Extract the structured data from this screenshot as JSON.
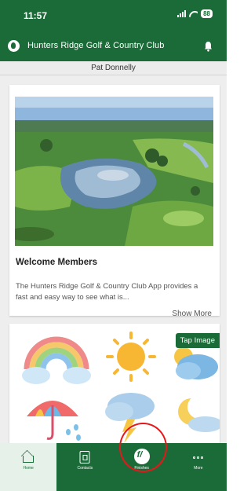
{
  "status_bar": {
    "time": "11:57",
    "battery": "88"
  },
  "header": {
    "title": "Hunters Ridge Golf & Country Club",
    "logo_icon": "golf-club-logo-icon",
    "bell_icon": "bell-icon"
  },
  "user": {
    "name": "Pat Donnelly"
  },
  "welcome_card": {
    "title": "Welcome Members",
    "text": "The Hunters Ridge Golf & Country Club App provides a fast and easy way to see what is...",
    "show_more": "Show More"
  },
  "weather_card": {
    "button_label": "Tap Image"
  },
  "nav": {
    "items": [
      {
        "label": "Home",
        "icon": "home-icon",
        "active": true
      },
      {
        "label": "Contacts",
        "icon": "contacts-icon",
        "active": false
      },
      {
        "label": "Finishes",
        "icon": "finishes-icon",
        "active": false
      },
      {
        "label": "More",
        "icon": "more-icon",
        "active": false
      }
    ]
  },
  "colors": {
    "brand": "#1a6b38",
    "highlight": "#e8161b",
    "background": "#eeeeee"
  }
}
